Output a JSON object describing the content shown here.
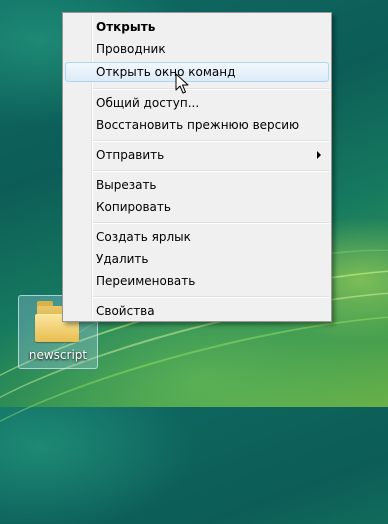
{
  "desktop": {
    "icon_label": "newscript",
    "icon_name": "folder-icon"
  },
  "context_menu": {
    "items": [
      {
        "label": "Открыть"
      },
      {
        "label": "Проводник"
      },
      {
        "label": "Открыть окно команд"
      },
      {
        "label": "Общий доступ..."
      },
      {
        "label": "Восстановить прежнюю версию"
      },
      {
        "label": "Отправить"
      },
      {
        "label": "Вырезать"
      },
      {
        "label": "Копировать"
      },
      {
        "label": "Создать ярлык"
      },
      {
        "label": "Удалить"
      },
      {
        "label": "Переименовать"
      },
      {
        "label": "Свойства"
      }
    ],
    "default_item": "Открыть",
    "hovered_item": "Открыть окно команд",
    "submenu_item": "Отправить"
  },
  "colors": {
    "hover_border": "#a8d8f2",
    "menu_background": "#f0f0f0"
  }
}
